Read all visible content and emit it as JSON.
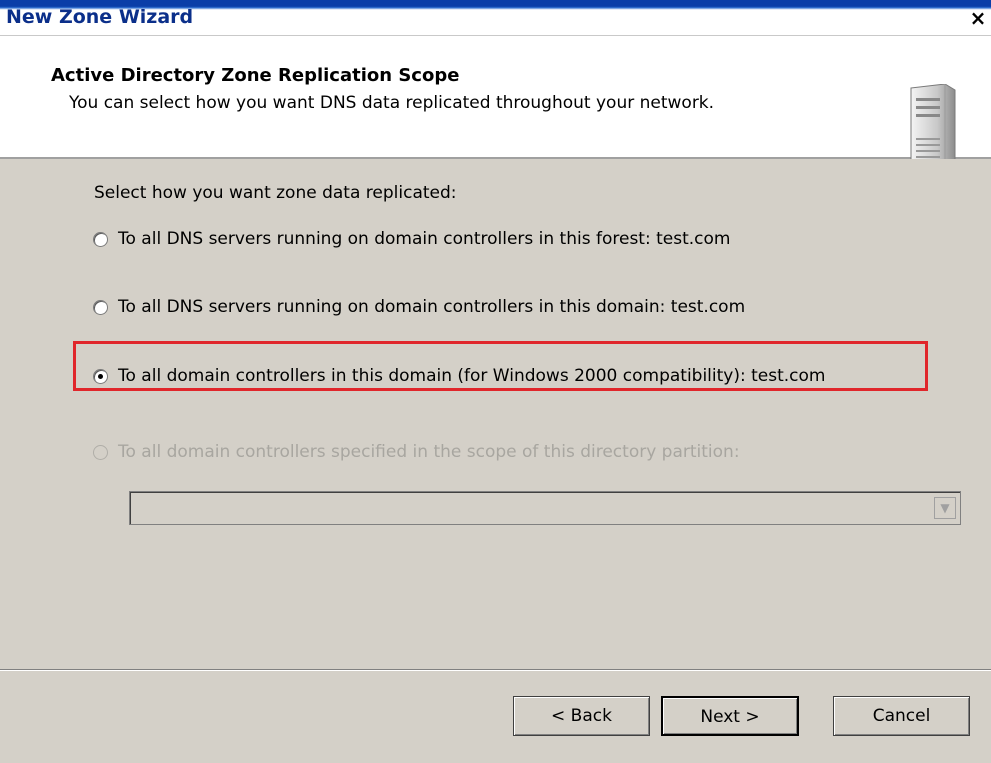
{
  "window": {
    "title": "New Zone Wizard",
    "close_glyph": "×"
  },
  "header": {
    "title": "Active Directory Zone Replication Scope",
    "subtitle": "You can select how you want DNS data replicated throughout your network.",
    "icon": "server-icon"
  },
  "body": {
    "prompt": "Select how you want zone data replicated:",
    "options": [
      {
        "label": "To all DNS servers running on domain controllers in this forest: test.com",
        "checked": false,
        "enabled": true
      },
      {
        "label": "To all DNS servers running on domain controllers in this domain: test.com",
        "checked": false,
        "enabled": true
      },
      {
        "label": "To all domain controllers in this domain (for Windows 2000 compatibility): test.com",
        "checked": true,
        "enabled": true
      },
      {
        "label": "To all domain controllers specified in the scope of this directory partition:",
        "checked": false,
        "enabled": false
      }
    ],
    "partition_select": {
      "value": "",
      "enabled": false
    },
    "highlight_color": "#e0262b"
  },
  "footer": {
    "back_label": "< Back",
    "next_label": "Next >",
    "cancel_label": "Cancel"
  }
}
